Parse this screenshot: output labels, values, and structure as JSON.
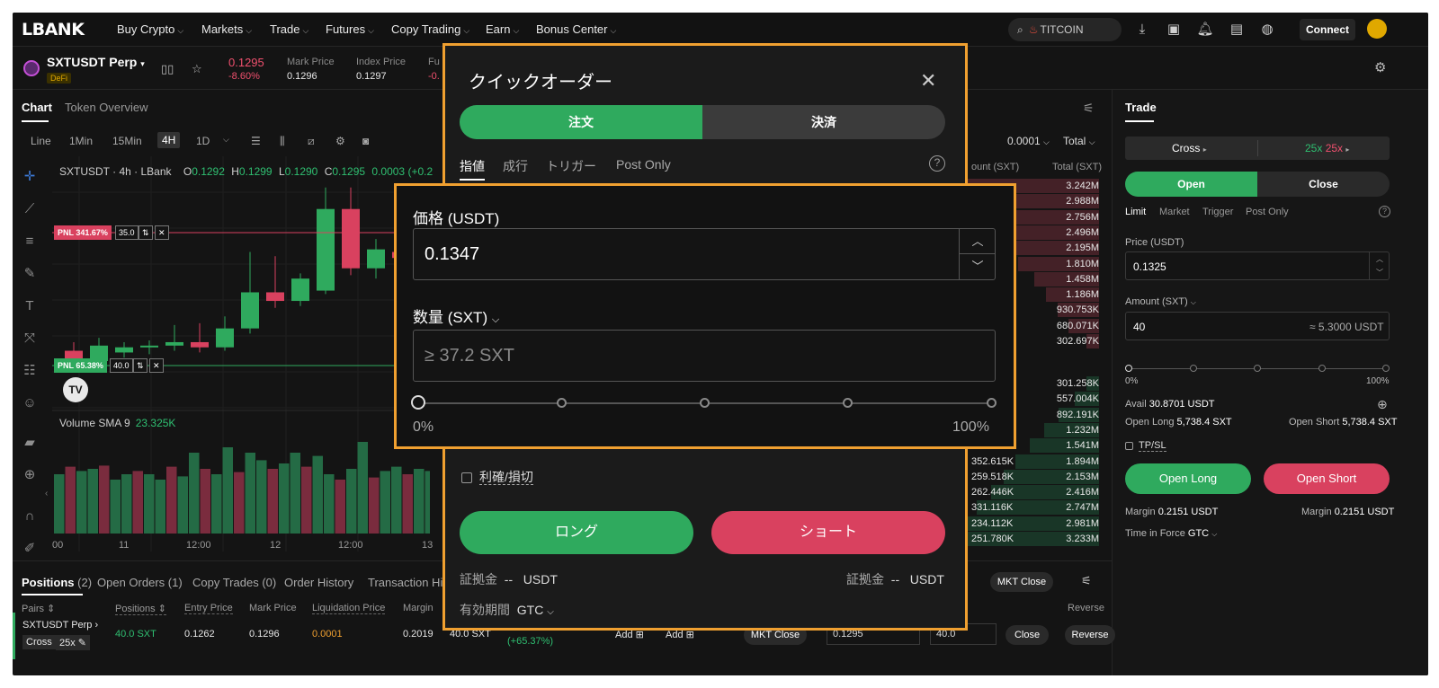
{
  "brand": "LBANK",
  "nav": {
    "items": [
      "Buy Crypto",
      "Markets",
      "Trade",
      "Futures",
      "Copy Trading",
      "Earn",
      "Bonus Center"
    ],
    "search_text": "TITCOIN",
    "connect_label": "Connect"
  },
  "ticker": {
    "pair": "SXTUSDT Perp",
    "tag": "DeFi",
    "price": "0.1295",
    "change": "-8.60%",
    "mark_label": "Mark Price",
    "mark_value": "0.1296",
    "index_label": "Index Price",
    "index_value": "0.1297",
    "fund_label": "Fu",
    "fund_value": "-0."
  },
  "chart_tabs": [
    "Chart",
    "Token Overview"
  ],
  "intervals": [
    "Line",
    "1Min",
    "15Min",
    "4H",
    "1D"
  ],
  "active_interval": "4H",
  "chart": {
    "info_prefix": "SXTUSDT · 4h · LBank",
    "o": "0.1292",
    "h": "0.1299",
    "l": "0.1290",
    "c": "0.1295",
    "chg": "0.0003 (+0.2",
    "pnl1": "PNL 341.67%",
    "pnl1_qty": "35.0",
    "pnl2": "PNL 65.38%",
    "pnl2_qty": "40.0",
    "volume_label": "Volume SMA 9",
    "volume_value": "23.325K",
    "xticks": [
      "00",
      "11",
      "12:00",
      "12",
      "12:00",
      "13"
    ],
    "tv": "TV"
  },
  "chart_data": {
    "type": "candlestick",
    "candles": [
      {
        "o": 0.123,
        "c": 0.1218,
        "h": 0.124,
        "l": 0.1205,
        "up": false
      },
      {
        "o": 0.1218,
        "c": 0.1236,
        "h": 0.1245,
        "l": 0.1212,
        "up": true
      },
      {
        "o": 0.1228,
        "c": 0.1234,
        "h": 0.124,
        "l": 0.1222,
        "up": true
      },
      {
        "o": 0.1234,
        "c": 0.1236,
        "h": 0.1242,
        "l": 0.1226,
        "up": true
      },
      {
        "o": 0.1236,
        "c": 0.124,
        "h": 0.126,
        "l": 0.123,
        "up": true
      },
      {
        "o": 0.124,
        "c": 0.1234,
        "h": 0.1262,
        "l": 0.1228,
        "up": false
      },
      {
        "o": 0.1234,
        "c": 0.1256,
        "h": 0.127,
        "l": 0.123,
        "up": true
      },
      {
        "o": 0.1256,
        "c": 0.1298,
        "h": 0.1345,
        "l": 0.125,
        "up": true
      },
      {
        "o": 0.1298,
        "c": 0.1288,
        "h": 0.134,
        "l": 0.128,
        "up": false
      },
      {
        "o": 0.1288,
        "c": 0.1314,
        "h": 0.132,
        "l": 0.1282,
        "up": true
      },
      {
        "o": 0.13,
        "c": 0.1395,
        "h": 0.142,
        "l": 0.1296,
        "up": true
      },
      {
        "o": 0.1395,
        "c": 0.1326,
        "h": 0.142,
        "l": 0.1318,
        "up": false
      },
      {
        "o": 0.1326,
        "c": 0.1348,
        "h": 0.136,
        "l": 0.1314,
        "up": true
      },
      {
        "o": 0.1345,
        "c": 0.1338,
        "h": 0.1354,
        "l": 0.1325,
        "up": false
      }
    ],
    "volumes": [
      0.55,
      0.62,
      0.58,
      0.6,
      0.63,
      0.5,
      0.55,
      0.58,
      0.55,
      0.5,
      0.62,
      0.53,
      0.75,
      0.6,
      0.55,
      0.8,
      0.57,
      0.75,
      0.68,
      0.6,
      0.65,
      0.75,
      0.62,
      0.72,
      0.55,
      0.5,
      0.6,
      0.85,
      0.52,
      0.58,
      0.62,
      0.55,
      0.6,
      0.58
    ]
  },
  "orderbook": {
    "precision": "0.0001",
    "total_label": "Total",
    "amount_header": "ount (SXT)",
    "total_header": "Total (SXT)",
    "asks_total": [
      "3.242M",
      "2.988M",
      "2.756M",
      "2.496M",
      "2.195M",
      "1.810M",
      "1.458M",
      "1.186M",
      "930.753K",
      "680.071K",
      "302.697K"
    ],
    "bids_amount": [
      "",
      "",
      "",
      "",
      "",
      "352.615K",
      "259.518K",
      "262.446K",
      "331.116K",
      "234.112K",
      "251.780K"
    ],
    "bids_total": [
      "301.258K",
      "557.004K",
      "892.191K",
      "1.232M",
      "1.541M",
      "1.894M",
      "2.153M",
      "2.416M",
      "2.747M",
      "2.981M",
      "3.233M"
    ],
    "ask_depth": [
      1.0,
      0.92,
      0.85,
      0.77,
      0.68,
      0.56,
      0.45,
      0.37,
      0.29,
      0.21,
      0.09
    ],
    "bid_depth": [
      0.09,
      0.17,
      0.28,
      0.38,
      0.48,
      0.58,
      0.66,
      0.75,
      0.85,
      0.92,
      1.0
    ]
  },
  "trade": {
    "title": "Trade",
    "cross": "Cross",
    "lev1": "25x",
    "lev2": "25x",
    "open": "Open",
    "close": "Close",
    "order_types": [
      "Limit",
      "Market",
      "Trigger",
      "Post Only"
    ],
    "price_label": "Price (USDT)",
    "price_value": "0.1325",
    "amount_label": "Amount (SXT)",
    "amount_value": "40",
    "amount_usdt": "≈ 5.3000 USDT",
    "pct_min": "0%",
    "pct_max": "100%",
    "avail_label": "Avail",
    "avail_value": "30.8701 USDT",
    "open_long_label": "Open Long",
    "open_long_value": "5,738.4 SXT",
    "open_short_label": "Open Short",
    "open_short_value": "5,738.4 SXT",
    "tpsl": "TP/SL",
    "open_long_btn": "Open Long",
    "open_short_btn": "Open Short",
    "margin_label": "Margin",
    "margin_long": "0.2151 USDT",
    "margin_short": "0.2151 USDT",
    "tif_label": "Time in Force",
    "tif_value": "GTC"
  },
  "positions": {
    "tabs": [
      {
        "label": "Positions",
        "count": "(2)"
      },
      {
        "label": "Open Orders",
        "count": "(1)"
      },
      {
        "label": "Copy Trades",
        "count": "(0)"
      },
      {
        "label": "Order History",
        "count": ""
      },
      {
        "label": "Transaction His",
        "count": ""
      }
    ],
    "mkt_close_all": "MKT Close",
    "headers": [
      "Pairs",
      "Positions",
      "Entry Price",
      "Mark Price",
      "Liquidation Price",
      "Margin"
    ],
    "reverse_header": "Reverse",
    "row": {
      "pair": "SXTUSDT Perp",
      "mode": "Cross",
      "lev": "25x",
      "size": "40.0 SXT",
      "entry": "0.1262",
      "mark": "0.1296",
      "liq": "0.0001",
      "margin": "0.2019",
      "size2": "40.0 SXT",
      "pnl_pct": "(+65.37%)",
      "add1": "Add",
      "add2": "Add",
      "mkt_close": "MKT Close",
      "price_in": "0.1295",
      "qty_in": "40.0",
      "close": "Close",
      "reverse": "Reverse"
    }
  },
  "quick_order": {
    "title": "クイックオーダー",
    "tab_order": "注文",
    "tab_settle": "決済",
    "sub_tabs": [
      "指値",
      "成行",
      "トリガー",
      "Post Only"
    ],
    "price_label": "価格 (USDT)",
    "price_value": "0.1347",
    "qty_label": "数量 (SXT)",
    "qty_placeholder": "≥ 37.2 SXT",
    "pct_min": "0%",
    "pct_max": "100%",
    "tpsl": "利確/損切",
    "long_btn": "ロング",
    "short_btn": "ショート",
    "margin_label": "証拠金",
    "margin_value": "--",
    "margin_unit": "USDT",
    "validity_label": "有効期間",
    "validity_value": "GTC"
  },
  "colors": {
    "green": "#2faa5e",
    "red": "#d9415f",
    "highlight": "#f0a030"
  }
}
